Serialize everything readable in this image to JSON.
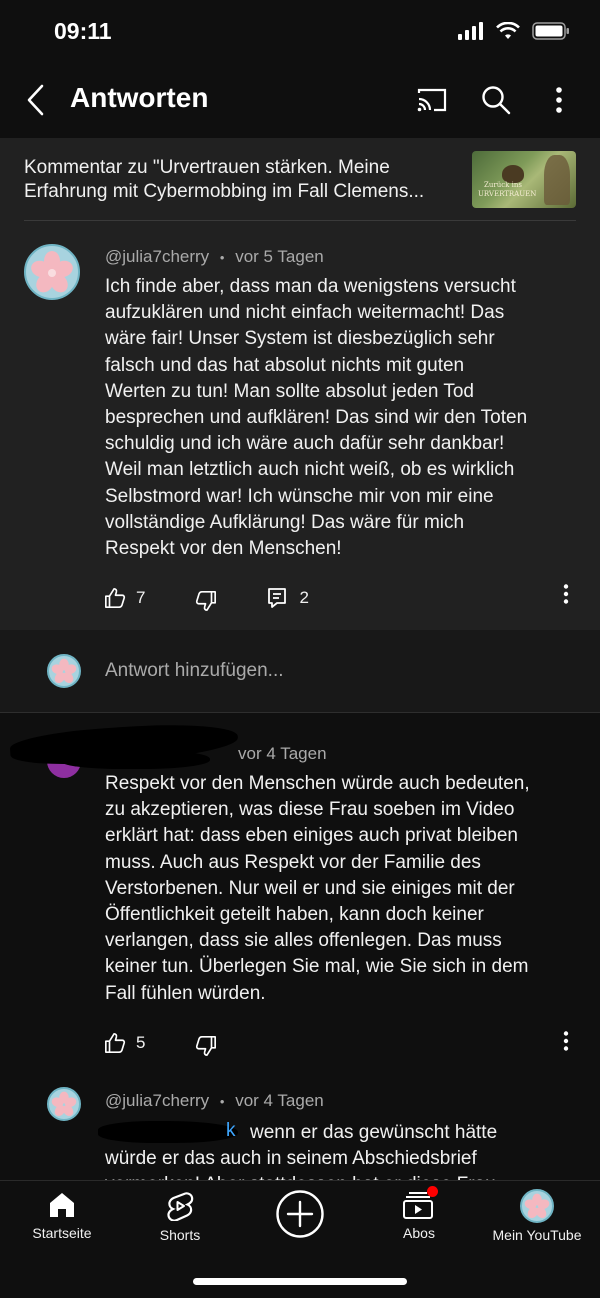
{
  "status_bar": {
    "time": "09:11"
  },
  "header": {
    "title": "Antworten",
    "icons": [
      "back-chevron-icon",
      "cast-icon",
      "search-icon",
      "more-vertical-icon"
    ]
  },
  "context": {
    "line1": "Kommentar zu \"Urvertrauen stärken. Meine",
    "line2": "Erfahrung mit Cybermobbing im Fall Clemens...",
    "thumbnail_text": "Zurück ins URVERTRAUEN"
  },
  "main_comment": {
    "author": "@julia7cherry",
    "separator": "•",
    "time": "vor 5 Tagen",
    "lines": [
      "Ich finde aber, dass man da wenigstens versucht",
      "aufzuklären und nicht einfach weitermacht! Das",
      "wäre fair! Unser System ist diesbezüglich sehr",
      "falsch und das hat absolut nichts mit guten",
      "Werten zu tun! Man sollte absolut jeden Tod",
      "besprechen und aufklären! Das sind wir den Toten",
      "schuldig und ich wäre auch dafür sehr dankbar!",
      "Weil man letztlich auch nicht weiß, ob es wirklich",
      "Selbstmord war! Ich wünsche mir von mir eine",
      "vollständige Aufklärung! Das wäre für mich",
      "Respekt vor den Menschen!"
    ],
    "likes": "7",
    "replies": "2"
  },
  "reply_input": {
    "placeholder": "Antwort hinzufügen..."
  },
  "replies": [
    {
      "time": "vor 4 Tagen",
      "lines": [
        "Respekt vor den Menschen würde auch bedeuten,",
        "zu akzeptieren, was diese Frau soeben im Video",
        "erklärt hat: dass eben einiges auch privat bleiben",
        "muss. Auch aus Respekt vor der Familie des",
        "Verstorbenen. Nur weil er und sie einiges mit der",
        "Öffentlichkeit geteilt haben, kann doch keiner",
        "verlangen, dass sie alles offenlegen. Das muss",
        "keiner tun. Überlegen Sie mal, wie Sie sich in dem",
        "Fall fühlen würden."
      ],
      "likes": "5"
    },
    {
      "author": "@julia7cherry",
      "separator": "•",
      "time": "vor 4 Tagen",
      "mention_tail": "k",
      "line1": "wenn er das gewünscht hätte",
      "line2": "würde er das auch in seinem Abschiedsbrief",
      "line3": "vermerken! Aber stattdessen hat er diese Frau"
    }
  ],
  "bottom_nav": {
    "items": [
      {
        "label": "Startseite",
        "icon": "home-icon"
      },
      {
        "label": "Shorts",
        "icon": "shorts-icon"
      },
      {
        "label": "",
        "icon": "create-plus-icon"
      },
      {
        "label": "Abos",
        "icon": "subscriptions-icon"
      },
      {
        "label": "Mein YouTube",
        "icon": "avatar"
      }
    ]
  },
  "colors": {
    "background": "#0f0f0f",
    "card": "#212121",
    "text_secondary": "#aaaaaa",
    "mention": "#3ea6ff",
    "notification_dot": "#ff0000"
  }
}
